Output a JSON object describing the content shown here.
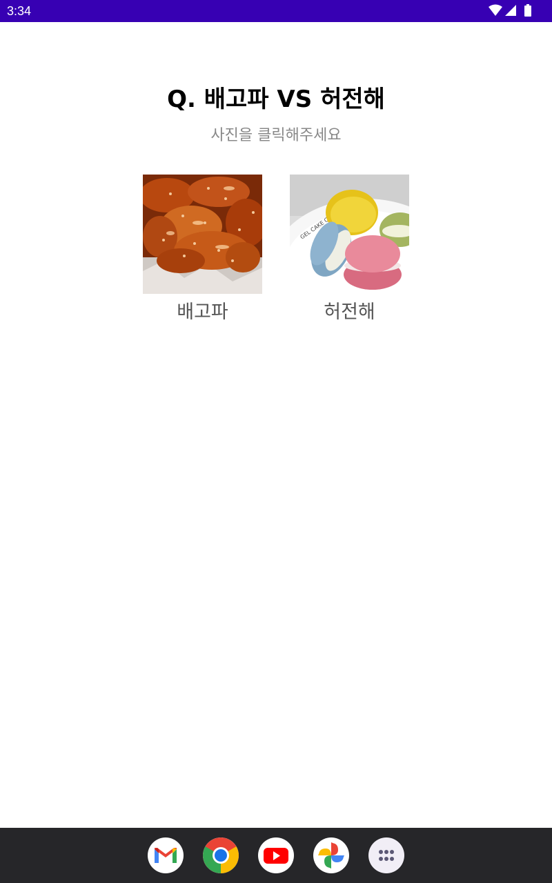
{
  "status_bar": {
    "time": "3:34",
    "icons": [
      "wifi-icon",
      "signal-icon",
      "battery-icon"
    ],
    "background": "#3700b3"
  },
  "quiz": {
    "title": "Q. 배고파 VS 허전해",
    "subtitle": "사진을 클릭해주세요",
    "choices": [
      {
        "label": "배고파",
        "image": "fried-chicken-photo"
      },
      {
        "label": "허전해",
        "image": "macarons-photo"
      }
    ]
  },
  "dock": {
    "apps": [
      {
        "name": "Gmail",
        "icon": "gmail-icon"
      },
      {
        "name": "Chrome",
        "icon": "chrome-icon"
      },
      {
        "name": "YouTube",
        "icon": "youtube-icon"
      },
      {
        "name": "Photos",
        "icon": "photos-icon"
      },
      {
        "name": "All apps",
        "icon": "app-drawer-icon"
      }
    ],
    "background": "#262629"
  }
}
